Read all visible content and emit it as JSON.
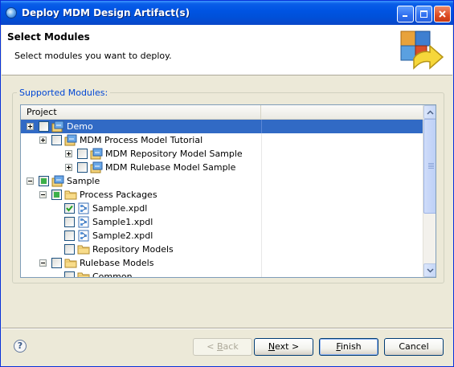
{
  "window": {
    "title": "Deploy MDM Design Artifact(s)"
  },
  "header": {
    "title": "Select Modules",
    "description": "Select modules you want to deploy."
  },
  "group": {
    "label": "Supported Modules:"
  },
  "tree": {
    "column_header": "Project",
    "rows": [
      {
        "label": "Demo",
        "selected": true,
        "check": "unchecked",
        "expander": "plus",
        "icon": "project-icon"
      },
      {
        "label": "MDM Process Model Tutorial",
        "check": "unchecked",
        "expander": "plus",
        "icon": "project-icon"
      },
      {
        "label": "MDM Repository Model Sample",
        "check": "unchecked",
        "expander": "plus",
        "icon": "project-icon"
      },
      {
        "label": "MDM Rulebase Model Sample",
        "check": "unchecked",
        "expander": "plus",
        "icon": "project-icon"
      },
      {
        "label": "Sample",
        "check": "partial",
        "expander": "minus",
        "icon": "project-icon"
      },
      {
        "label": "Process Packages",
        "check": "partial",
        "expander": "minus",
        "icon": "folder-icon"
      },
      {
        "label": "Sample.xpdl",
        "check": "checked",
        "icon": "xpdl-file-icon"
      },
      {
        "label": "Sample1.xpdl",
        "check": "unchecked",
        "icon": "xpdl-file-icon"
      },
      {
        "label": "Sample2.xpdl",
        "check": "unchecked",
        "icon": "xpdl-file-icon"
      },
      {
        "label": "Repository Models",
        "check": "unchecked",
        "icon": "folder-icon"
      },
      {
        "label": "Rulebase Models",
        "check": "unchecked",
        "expander": "minus",
        "icon": "folder-icon"
      },
      {
        "label": "Common",
        "check": "unchecked",
        "icon": "folder-icon"
      }
    ]
  },
  "buttons": {
    "back_prefix": "< ",
    "back_key": "B",
    "back_rest": "ack",
    "next_key": "N",
    "next_rest": "ext >",
    "finish_key": "F",
    "finish_rest": "inish",
    "cancel": "Cancel",
    "help": "?"
  },
  "colors": {
    "title_bar": "#0054e3",
    "selection": "#316ac5",
    "group_label": "#0046d5"
  }
}
